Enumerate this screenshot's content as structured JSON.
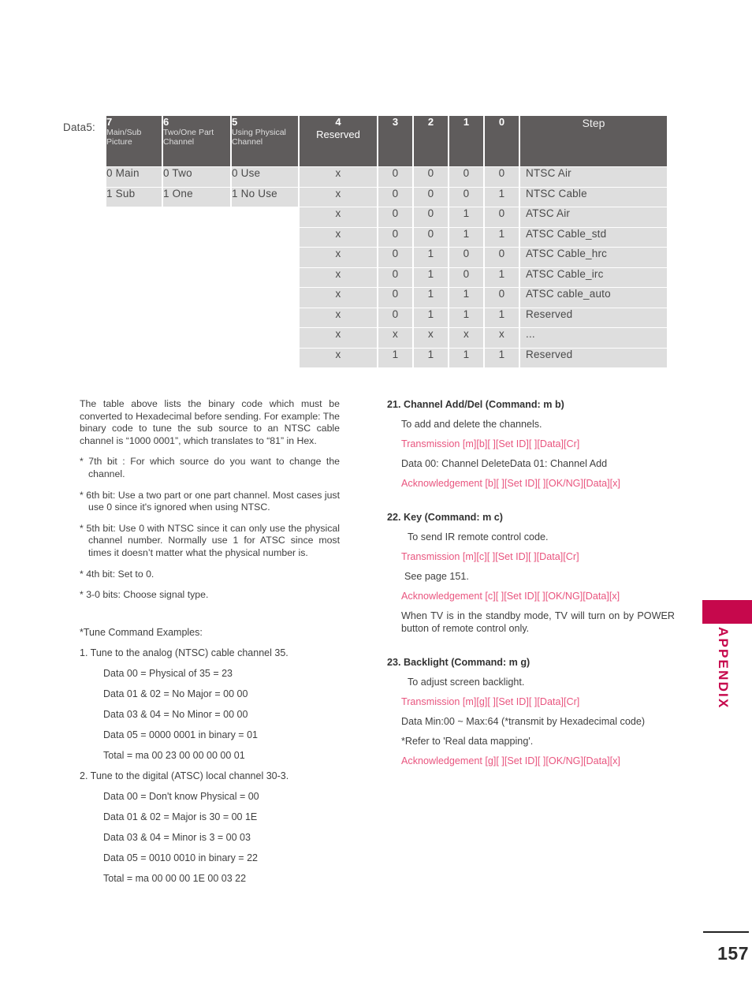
{
  "table": {
    "row_label": "Data5:",
    "headers": [
      {
        "num": "7",
        "sub": "Main/Sub\nPicture"
      },
      {
        "num": "6",
        "sub": "Two/One Part\nChannel"
      },
      {
        "num": "5",
        "sub": "Using Physical\nChannel"
      },
      {
        "num": "4",
        "sub": "Reserved"
      },
      {
        "num": "3",
        "sub": ""
      },
      {
        "num": "2",
        "sub": ""
      },
      {
        "num": "1",
        "sub": ""
      },
      {
        "num": "0",
        "sub": ""
      },
      {
        "num": "Step",
        "sub": ""
      }
    ],
    "header_7_line1": "Main/Sub",
    "header_7_line2": "Picture",
    "header_6_line1": "Two/One Part",
    "header_6_line2": "Channel",
    "header_5_line1": "Using Physical",
    "header_5_line2": "Channel",
    "header_4_sub": "Reserved",
    "rows": [
      {
        "b7": "0 Main",
        "b6": "0 Two",
        "b5": "0 Use",
        "b4": "x",
        "b3": "0",
        "b2": "0",
        "b1": "0",
        "b0": "0",
        "step": "NTSC Air"
      },
      {
        "b7": "1 Sub",
        "b6": "1 One",
        "b5": "1 No Use",
        "b4": "x",
        "b3": "0",
        "b2": "0",
        "b1": "0",
        "b0": "1",
        "step": "NTSC Cable"
      },
      {
        "b7": "",
        "b6": "",
        "b5": "",
        "b4": "x",
        "b3": "0",
        "b2": "0",
        "b1": "1",
        "b0": "0",
        "step": "ATSC Air"
      },
      {
        "b7": "",
        "b6": "",
        "b5": "",
        "b4": "x",
        "b3": "0",
        "b2": "0",
        "b1": "1",
        "b0": "1",
        "step": "ATSC Cable_std"
      },
      {
        "b7": "",
        "b6": "",
        "b5": "",
        "b4": "x",
        "b3": "0",
        "b2": "1",
        "b1": "0",
        "b0": "0",
        "step": "ATSC Cable_hrc"
      },
      {
        "b7": "",
        "b6": "",
        "b5": "",
        "b4": "x",
        "b3": "0",
        "b2": "1",
        "b1": "0",
        "b0": "1",
        "step": "ATSC Cable_irc"
      },
      {
        "b7": "",
        "b6": "",
        "b5": "",
        "b4": "x",
        "b3": "0",
        "b2": "1",
        "b1": "1",
        "b0": "0",
        "step": "ATSC cable_auto"
      },
      {
        "b7": "",
        "b6": "",
        "b5": "",
        "b4": "x",
        "b3": "0",
        "b2": "1",
        "b1": "1",
        "b0": "1",
        "step": "Reserved"
      },
      {
        "b7": "",
        "b6": "",
        "b5": "",
        "b4": "x",
        "b3": "x",
        "b2": "x",
        "b1": "x",
        "b0": "x",
        "step": "..."
      },
      {
        "b7": "",
        "b6": "",
        "b5": "",
        "b4": "x",
        "b3": "1",
        "b2": "1",
        "b1": "1",
        "b0": "1",
        "step": "Reserved"
      }
    ]
  },
  "left_column": {
    "intro": "The table above lists the binary code which must be converted to Hexadecimal before sending. For example: The binary code to tune the sub source to an NTSC cable channel is “1000 0001”, which translates to “81” in Hex.",
    "bullets": [
      "* 7th bit : For which source do you want to change the channel.",
      "* 6th bit: Use a two part or one part channel. Most cases just use 0 since it's ignored when using NTSC.",
      "* 5th bit: Use 0 with NTSC since it can only use the physical channel number. Normally use 1 for ATSC since most times it doesn’t  matter what the physical number is.",
      "* 4th bit: Set to 0.",
      "* 3-0 bits: Choose signal type."
    ],
    "examples_header": "*Tune Command Examples:",
    "example1_title": "1. Tune to the analog (NTSC) cable channel 35.",
    "example1_lines": [
      "Data  00 = Physical of 35 = 23",
      "Data 01 & 02 = No Major = 00 00",
      "Data 03 & 04 = No Minor = 00 00",
      "Data 05 = 0000 0001 in binary = 01",
      "Total = ma 00 23 00 00 00 00 01"
    ],
    "example2_title": "2. Tune to the digital (ATSC) local channel 30-3.",
    "example2_lines": [
      "Data  00 = Don't know Physical = 00",
      "Data 01 & 02 = Major is 30 = 00 1E",
      "Data 03 & 04 = Minor is 3 = 00 03",
      "Data 05 = 0010 0010 in binary = 22",
      "Total = ma 00 00 00 1E 00 03 22"
    ]
  },
  "right_column": {
    "section21": {
      "title": "21. Channel Add/Del (Command: m b)",
      "desc": "To add and delete the channels.",
      "transmission": "Transmission [m][b][  ][Set ID][  ][Data][Cr]",
      "data_line": "Data 00: Channel DeleteData 01: Channel Add",
      "acknowledgement": "Acknowledgement [b][  ][Set ID][  ][OK/NG][Data][x]"
    },
    "section22": {
      "title": "22. Key (Command: m c)",
      "desc": "To send IR remote control code.",
      "transmission": "Transmission [m][c][  ][Set ID][  ][Data][Cr]",
      "see_page": "See page 151.",
      "acknowledgement": "Acknowledgement [c][  ][Set ID][  ][OK/NG][Data][x]",
      "note": "When TV is in the standby mode, TV will turn on by POWER button of remote control only."
    },
    "section23": {
      "title": "23. Backlight (Command: m g)",
      "desc": "To adjust screen backlight.",
      "transmission": "Transmission [m][g][  ][Set ID][  ][Data][Cr]",
      "data_line": "Data Min:00 ~ Max:64 (*transmit by Hexadecimal code)",
      "refer": "*Refer to 'Real data mapping'.",
      "acknowledgement": "Acknowledgement [g][  ][Set ID][  ][OK/NG][Data][x]"
    }
  },
  "sidebar": {
    "tab_label": "APPENDIX",
    "tab_color": "#c6084c"
  },
  "footer": {
    "page_number": "157"
  }
}
